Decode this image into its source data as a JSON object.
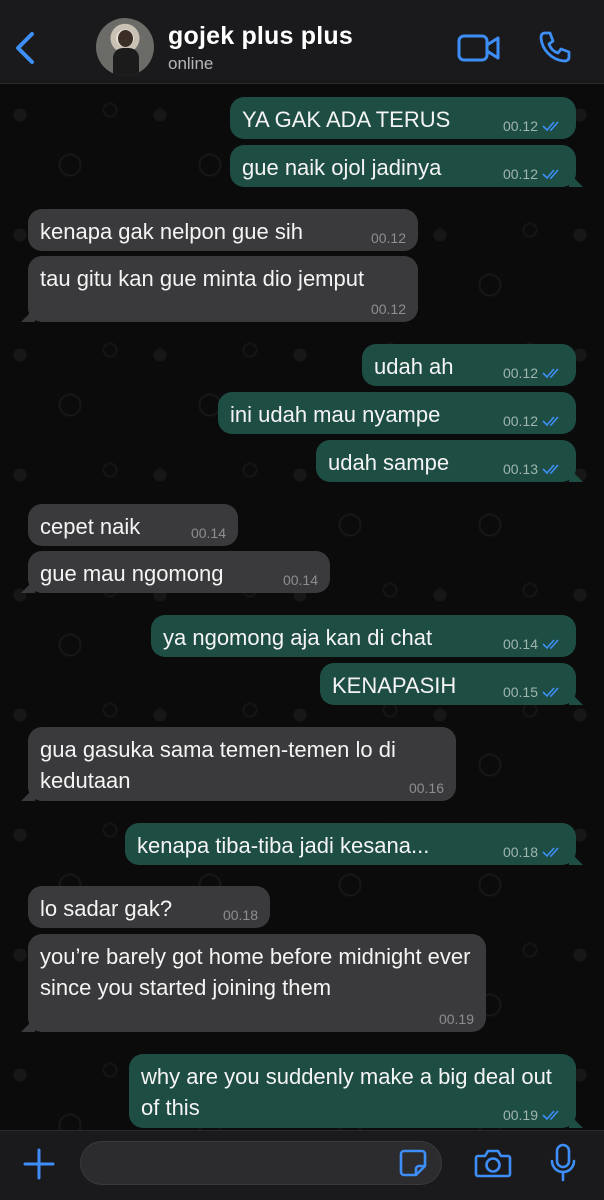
{
  "header": {
    "contact_name": "gojek plus plus",
    "status": "online",
    "accent_color": "#3e8ef7"
  },
  "messages": [
    {
      "dir": "out",
      "text": "YA GAK ADA TERUS",
      "time": "00.12",
      "read": true
    },
    {
      "dir": "out",
      "text": "gue naik ojol jadinya",
      "time": "00.12",
      "read": true
    },
    {
      "dir": "in",
      "text": "kenapa gak nelpon gue sih",
      "time": "00.12"
    },
    {
      "dir": "in",
      "text": "tau gitu kan gue minta dio jemput",
      "time": "00.12"
    },
    {
      "dir": "out",
      "text": "udah ah",
      "time": "00.12",
      "read": true
    },
    {
      "dir": "out",
      "text": "ini udah mau nyampe",
      "time": "00.12",
      "read": true
    },
    {
      "dir": "out",
      "text": "udah sampe",
      "time": "00.13",
      "read": true
    },
    {
      "dir": "in",
      "text": "cepet naik",
      "time": "00.14"
    },
    {
      "dir": "in",
      "text": "gue mau ngomong",
      "time": "00.14"
    },
    {
      "dir": "out",
      "text": "ya ngomong aja kan di chat",
      "time": "00.14",
      "read": true
    },
    {
      "dir": "out",
      "text": "KENAPASIH",
      "time": "00.15",
      "read": true
    },
    {
      "dir": "in",
      "text": "gua gasuka sama temen-temen lo di kedutaan",
      "time": "00.16"
    },
    {
      "dir": "out",
      "text": "kenapa tiba-tiba jadi kesana...",
      "time": "00.18",
      "read": true
    },
    {
      "dir": "in",
      "text": "lo sadar gak?",
      "time": "00.18"
    },
    {
      "dir": "in",
      "text": "you’re barely got home before midnight ever since you started joining them",
      "time": "00.19"
    },
    {
      "dir": "out",
      "text": "why are you suddenly make a big deal out of this",
      "time": "00.19",
      "read": true
    }
  ],
  "composer": {
    "value": "",
    "placeholder": ""
  },
  "icons": {
    "back": "chevron-left-icon",
    "video": "video-camera-icon",
    "call": "phone-icon",
    "attach": "plus-icon",
    "sticker": "sticker-icon",
    "camera": "camera-icon",
    "mic": "microphone-icon"
  }
}
